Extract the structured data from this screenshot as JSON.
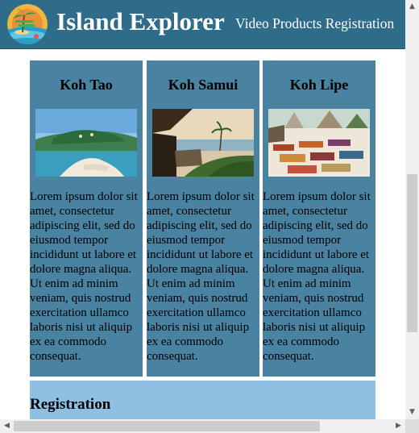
{
  "header": {
    "title": "Island Explorer",
    "subtitle": "Video Products Registration"
  },
  "cards": [
    {
      "title": "Koh Tao",
      "image": "island-beach-photo",
      "text": "Lorem ipsum dolor sit amet, consectetur adipiscing elit, sed do eiusmod tempor incididunt ut labore et dolore magna aliqua. Ut enim ad minim veniam, quis nostrud exercitation ullamco laboris nisi ut aliquip ex ea commodo consequat."
    },
    {
      "title": "Koh Samui",
      "image": "sunset-terrace-photo",
      "text": "Lorem ipsum dolor sit amet, consectetur adipiscing elit, sed do eiusmod tempor incididunt ut labore et dolore magna aliqua. Ut enim ad minim veniam, quis nostrud exercitation ullamco laboris nisi ut aliquip ex ea commodo consequat."
    },
    {
      "title": "Koh Lipe",
      "image": "beach-market-photo",
      "text": "Lorem ipsum dolor sit amet, consectetur adipiscing elit, sed do eiusmod tempor incididunt ut labore et dolore magna aliqua. Ut enim ad minim veniam, quis nostrud exercitation ullamco laboris nisi ut aliquip ex ea commodo consequat."
    }
  ],
  "registration": {
    "heading": "Registration"
  },
  "scrollbars": {
    "up_arrow": "▲",
    "down_arrow": "▼",
    "left_arrow": "◀",
    "right_arrow": "▶"
  },
  "colors": {
    "header_bg": "#2e6c8a",
    "card_bg": "#4a82a2",
    "registration_bg": "#8fbfe3"
  }
}
